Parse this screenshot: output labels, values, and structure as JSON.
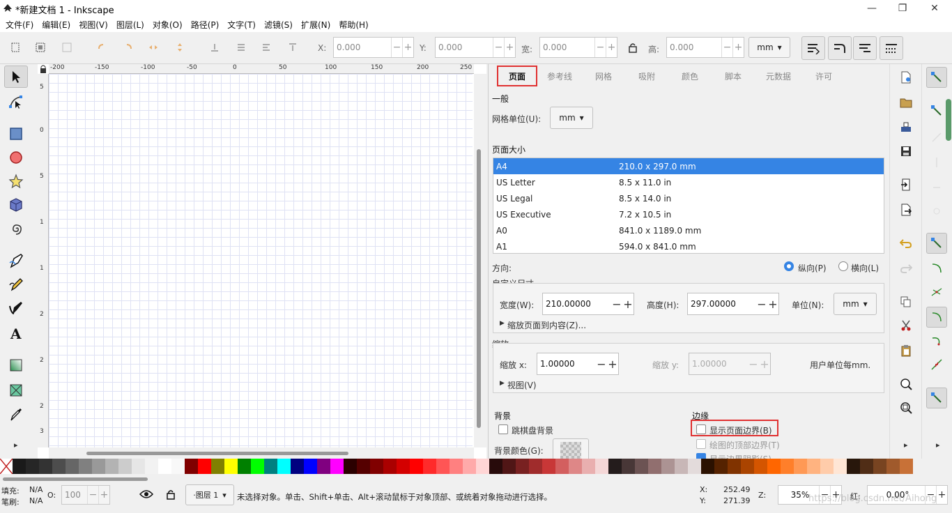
{
  "window": {
    "title": "*新建文档 1 - Inkscape",
    "minimize": "—",
    "maximize": "❐",
    "close": "✕"
  },
  "menu": [
    "文件(F)",
    "编辑(E)",
    "视图(V)",
    "图层(L)",
    "对象(O)",
    "路径(P)",
    "文字(T)",
    "滤镜(S)",
    "扩展(N)",
    "帮助(H)"
  ],
  "toolbar": {
    "x_label": "X:",
    "x_value": "0.000",
    "y_label": "Y:",
    "y_value": "0.000",
    "w_label": "宽:",
    "w_value": "0.000",
    "h_label": "高:",
    "h_value": "0.000",
    "unit": "mm",
    "stepper_minus": "−",
    "stepper_plus": "+"
  },
  "ruler": {
    "h_ticks": [
      "-200",
      "-150",
      "-100",
      "-50",
      "0",
      "50",
      "100",
      "150",
      "200",
      "250"
    ],
    "v_ticks": [
      "5",
      "0",
      "5",
      "1",
      "1",
      "2",
      "2",
      "2",
      "3"
    ]
  },
  "panel": {
    "tabs": [
      "页面",
      "参考线",
      "网格",
      "吸附",
      "颜色",
      "脚本",
      "元数据",
      "许可"
    ],
    "general_title": "一般",
    "grid_unit_label": "网格单位(U):",
    "grid_unit_value": "mm",
    "page_size_title": "页面大小",
    "page_sizes": [
      {
        "name": "A4",
        "size": "210.0 x 297.0 mm"
      },
      {
        "name": "US Letter",
        "size": "8.5 x 11.0 in"
      },
      {
        "name": "US Legal",
        "size": "8.5 x 14.0 in"
      },
      {
        "name": "US Executive",
        "size": "7.2 x 10.5 in"
      },
      {
        "name": "A0",
        "size": "841.0 x 1189.0 mm"
      },
      {
        "name": "A1",
        "size": "594.0 x 841.0 mm"
      }
    ],
    "orientation_label": "方向:",
    "portrait_label": "纵向(P)",
    "landscape_label": "横向(L)",
    "custom_size_title": "自定义尺寸",
    "width_label": "宽度(W):",
    "width_value": "210.00000",
    "height_label": "高度(H):",
    "height_value": "297.00000",
    "unit_label": "单位(N):",
    "unit_value": "mm",
    "resize_label": "缩放页面到内容(Z)...",
    "scale_title": "缩放",
    "scale_x_label": "缩放 x:",
    "scale_x_value": "1.00000",
    "scale_y_label": "缩放 y:",
    "scale_y_value": "1.00000",
    "user_units_label": "用户单位每mm.",
    "viewbox_label": "视图(V)",
    "background_title": "背景",
    "checkerboard_label": "跳棋盘背景",
    "bgcolor_label": "背景颜色(G):",
    "border_title": "边缘",
    "show_border_label": "显示页面边界(B)",
    "border_on_top_label": "绘图的顶部边界(T)",
    "show_shadow_label": "显示边界阴影(S)"
  },
  "palette": [
    "#1a1a1a",
    "#262626",
    "#333333",
    "#4d4d4d",
    "#666666",
    "#808080",
    "#999999",
    "#b3b3b3",
    "#cccccc",
    "#e6e6e6",
    "#f2f2f2",
    "#ffffff",
    "#f8f8f8",
    "#800000",
    "#ff0000",
    "#808000",
    "#ffff00",
    "#008000",
    "#00ff00",
    "#008080",
    "#00ffff",
    "#000080",
    "#0000ff",
    "#800080",
    "#ff00ff",
    "#2b0000",
    "#550000",
    "#800000",
    "#aa0000",
    "#d40000",
    "#ff0000",
    "#ff2a2a",
    "#ff5555",
    "#ff8080",
    "#ffaaaa",
    "#ffd5d5",
    "#280b0b",
    "#501616",
    "#782121",
    "#a02c2c",
    "#c83737",
    "#d35f5f",
    "#de8787",
    "#e9afaf",
    "#f4d7d7",
    "#241c1c",
    "#483737",
    "#6c5353",
    "#916f6f",
    "#ac9393",
    "#c8b7b7",
    "#e3dbdb",
    "#2b1100",
    "#552200",
    "#803300",
    "#aa4400",
    "#d45500",
    "#ff6600",
    "#ff7f2a",
    "#ff9955",
    "#ffb380",
    "#ffccaa",
    "#ffe6d5",
    "#28170b",
    "#502d16",
    "#784421",
    "#a05a2c",
    "#c87137"
  ],
  "status": {
    "fill_label": "填充:",
    "fill_value": "N/A",
    "stroke_label": "笔刷:",
    "stroke_value": "N/A",
    "opacity_label": "O:",
    "opacity_value": "100",
    "layer_label": "·图层 1",
    "message": "未选择对象。单击、Shift+单击、Alt+滚动鼠标于对象顶部、或统着对象拖动进行选择。",
    "x_label": "X:",
    "x_value": "252.49",
    "y_label": "Y:",
    "y_value": "271.39",
    "z_label": "Z:",
    "zoom_value": "35%",
    "rotate_label": "红:",
    "rotate_value": "0.00°",
    "watermark": "https://blog.csdn.net/Aihong"
  }
}
